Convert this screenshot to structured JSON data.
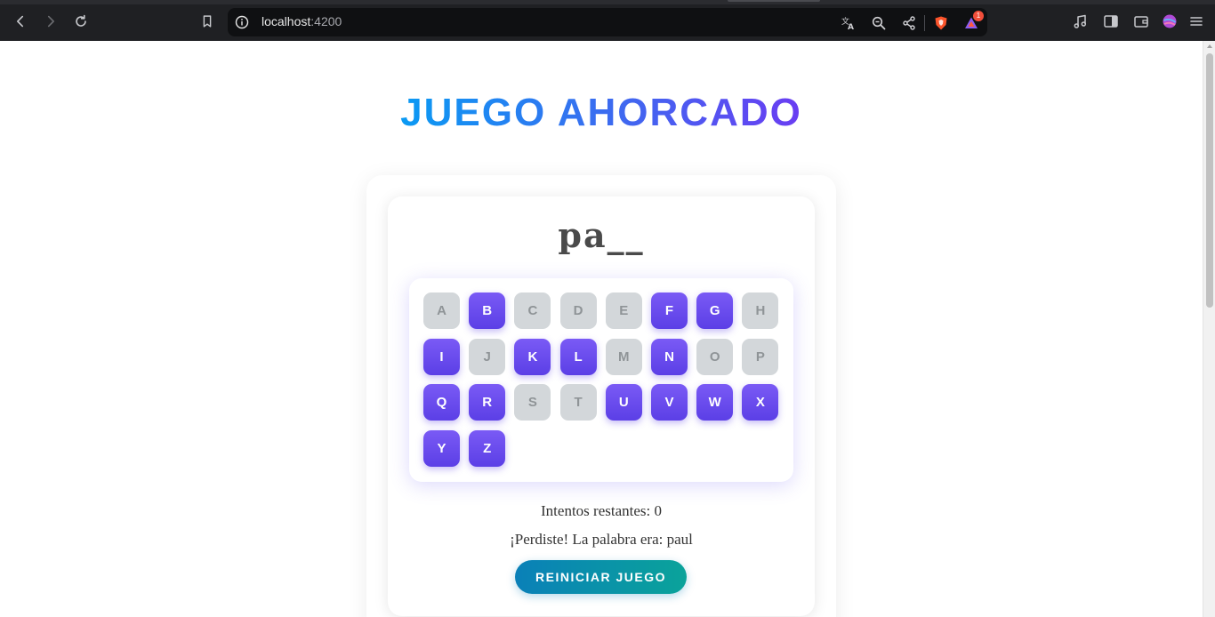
{
  "browser": {
    "url_host": "localhost",
    "url_port": ":4200",
    "notification_count": "1"
  },
  "game": {
    "title": "JUEGO AHORCADO",
    "word_display": "pa__",
    "letters": [
      {
        "letter": "A",
        "enabled": false
      },
      {
        "letter": "B",
        "enabled": true
      },
      {
        "letter": "C",
        "enabled": false
      },
      {
        "letter": "D",
        "enabled": false
      },
      {
        "letter": "E",
        "enabled": false
      },
      {
        "letter": "F",
        "enabled": true
      },
      {
        "letter": "G",
        "enabled": true
      },
      {
        "letter": "H",
        "enabled": false
      },
      {
        "letter": "I",
        "enabled": true
      },
      {
        "letter": "J",
        "enabled": false
      },
      {
        "letter": "K",
        "enabled": true
      },
      {
        "letter": "L",
        "enabled": true
      },
      {
        "letter": "M",
        "enabled": false
      },
      {
        "letter": "N",
        "enabled": true
      },
      {
        "letter": "O",
        "enabled": false
      },
      {
        "letter": "P",
        "enabled": false
      },
      {
        "letter": "Q",
        "enabled": true
      },
      {
        "letter": "R",
        "enabled": true
      },
      {
        "letter": "S",
        "enabled": false
      },
      {
        "letter": "T",
        "enabled": false
      },
      {
        "letter": "U",
        "enabled": true
      },
      {
        "letter": "V",
        "enabled": true
      },
      {
        "letter": "W",
        "enabled": true
      },
      {
        "letter": "X",
        "enabled": true
      },
      {
        "letter": "Y",
        "enabled": true
      },
      {
        "letter": "Z",
        "enabled": true
      }
    ],
    "attempts_text": "Intentos restantes: 0",
    "result_text": "¡Perdiste! La palabra era: paul",
    "reset_label": "REINICIAR JUEGO"
  },
  "colors": {
    "key_enabled": "#6a4df0",
    "key_disabled": "#d3d7da",
    "reset_button": "#0a93a8"
  }
}
